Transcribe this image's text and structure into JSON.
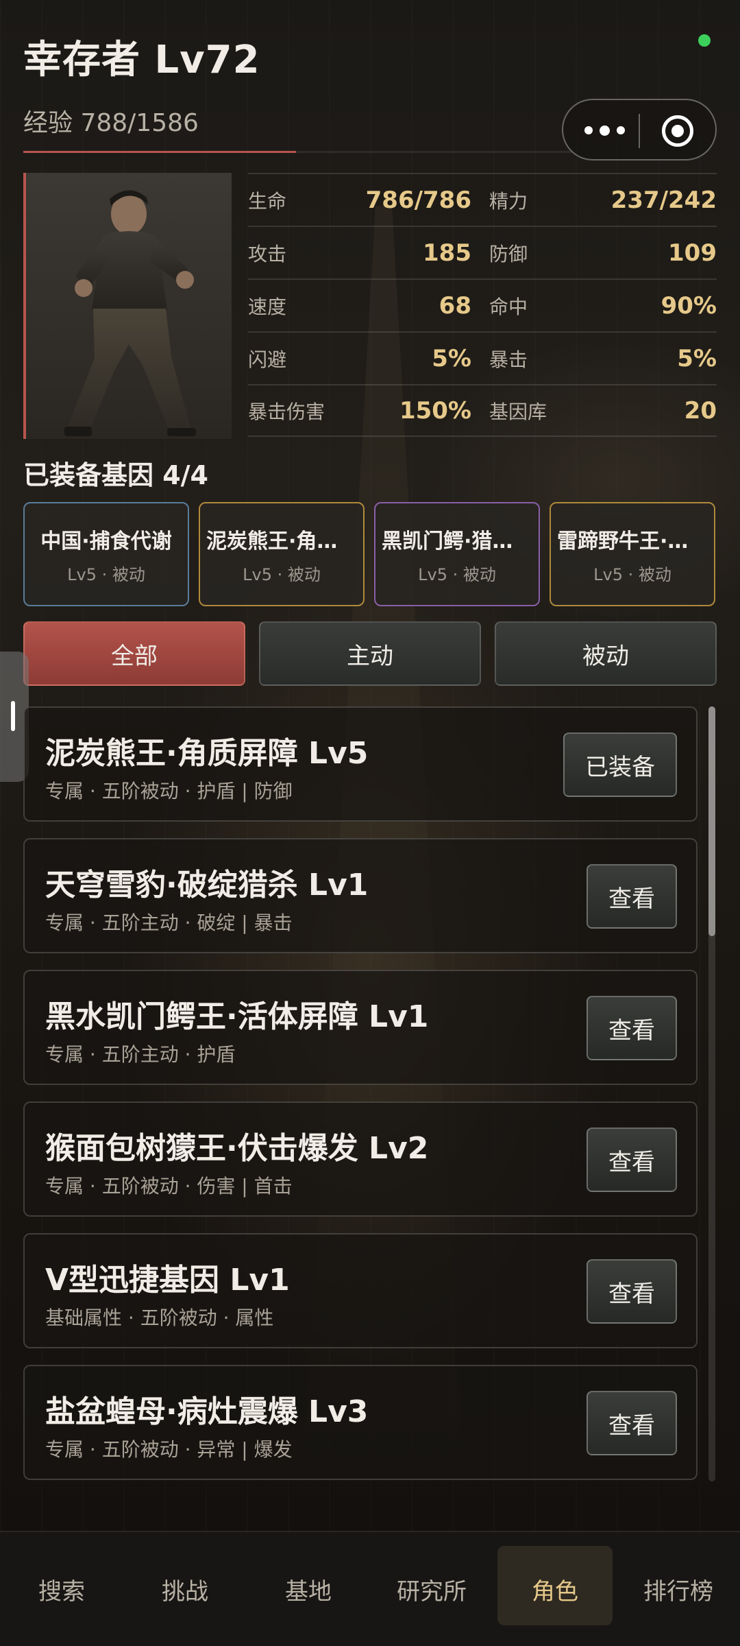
{
  "header": {
    "title": "幸存者 Lv72",
    "exp": "经验 788/1586",
    "exp_progress": 0.497,
    "status_color": "#3ccf5c"
  },
  "capsule": {
    "more_icon": "more-dots-icon",
    "close_icon": "target-circle-icon"
  },
  "stats": [
    {
      "l1": "生命",
      "v1": "786/786",
      "l2": "精力",
      "v2": "237/242"
    },
    {
      "l1": "攻击",
      "v1": "185",
      "l2": "防御",
      "v2": "109"
    },
    {
      "l1": "速度",
      "v1": "68",
      "l2": "命中",
      "v2": "90%"
    },
    {
      "l1": "闪避",
      "v1": "5%",
      "l2": "暴击",
      "v2": "5%"
    },
    {
      "l1": "暴击伤害",
      "v1": "150%",
      "l2": "基因库",
      "v2": "20"
    }
  ],
  "equipped": {
    "title": "已装备基因 4/4",
    "cards": [
      {
        "name": "中国·捕食代谢",
        "sub": "Lv5 · 被动",
        "border": "#5a7d9c"
      },
      {
        "name": "泥炭熊王·角质屏障",
        "sub": "Lv5 · 被动",
        "border": "#b08a3c"
      },
      {
        "name": "黑凯门鳄·猎杀之刃",
        "sub": "Lv5 · 被动",
        "border": "#8a5fa8"
      },
      {
        "name": "雷蹄野牛王·冲锋践踏",
        "sub": "Lv5 · 被动",
        "border": "#b08a3c"
      }
    ]
  },
  "filters": [
    "全部",
    "主动",
    "被动"
  ],
  "genes": [
    {
      "name": "泥炭熊王·角质屏障 Lv5",
      "tags": "专属 · 五阶被动 · 护盾 | 防御",
      "button": "已装备"
    },
    {
      "name": "天穹雪豹·破绽猎杀 Lv1",
      "tags": "专属 · 五阶主动 · 破绽 | 暴击",
      "button": "查看"
    },
    {
      "name": "黑水凯门鳄王·活体屏障 Lv1",
      "tags": "专属 · 五阶主动 · 护盾",
      "button": "查看"
    },
    {
      "name": "猴面包树獴王·伏击爆发 Lv2",
      "tags": "专属 · 五阶被动 · 伤害 | 首击",
      "button": "查看"
    },
    {
      "name": "V型迅捷基因 Lv1",
      "tags": "基础属性 · 五阶被动 · 属性",
      "button": "查看"
    },
    {
      "name": "盐盆蝗母·病灶震爆 Lv3",
      "tags": "专属 · 五阶被动 · 异常 | 爆发",
      "button": "查看"
    }
  ],
  "nav": [
    "搜索",
    "挑战",
    "基地",
    "研究所",
    "角色",
    "排行榜"
  ],
  "nav_active": 4
}
